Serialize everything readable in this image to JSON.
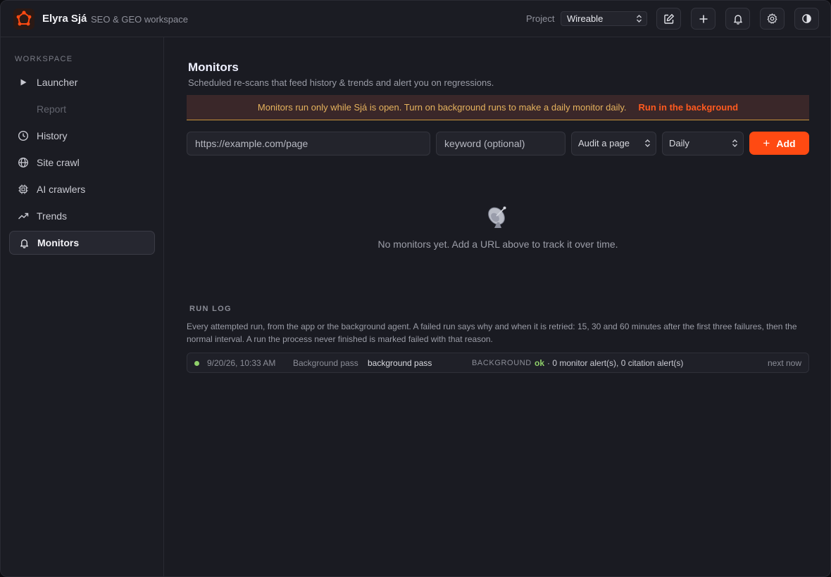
{
  "app": {
    "title": "Elyra Sjá",
    "subtitle": "SEO & GEO workspace"
  },
  "header": {
    "project_label": "Project",
    "project_value": "Wireable"
  },
  "sidebar": {
    "heading": "WORKSPACE",
    "items": [
      {
        "label": "Launcher"
      },
      {
        "label": "Report"
      },
      {
        "label": "History"
      },
      {
        "label": "Site crawl"
      },
      {
        "label": "AI crawlers"
      },
      {
        "label": "Trends"
      },
      {
        "label": "Monitors"
      }
    ]
  },
  "main": {
    "title": "Monitors",
    "description": "Scheduled re-scans that feed history & trends and alert you on regressions.",
    "banner": {
      "message": "Monitors run only while Sjá is open. Turn on background runs to make a daily monitor daily.",
      "link": "Run in the background"
    },
    "form": {
      "url_placeholder": "https://example.com/page",
      "keyword_placeholder": "keyword (optional)",
      "mode_value": "Audit a page",
      "frequency_value": "Daily",
      "add_label": "Add"
    },
    "empty_state": "No monitors yet. Add a URL above to track it over time.",
    "run_log": {
      "heading": "RUN LOG",
      "description": "Every attempted run, from the app or the background agent. A failed run says why and when it is retried: 15, 30 and 60 minutes after the first three failures, then the normal interval. A run the process never finished is marked failed with that reason.",
      "rows": [
        {
          "time": "9/20/26, 10:33 AM",
          "name": "Background pass",
          "desc": "background pass",
          "source": "BACKGROUND",
          "status": "ok",
          "alerts": "· 0 monitor alert(s), 0 citation alert(s)",
          "next": "next now"
        }
      ]
    }
  },
  "colors": {
    "accent": "#ff4a12",
    "ok": "#8fd06a",
    "warning": "#e5b25d"
  }
}
